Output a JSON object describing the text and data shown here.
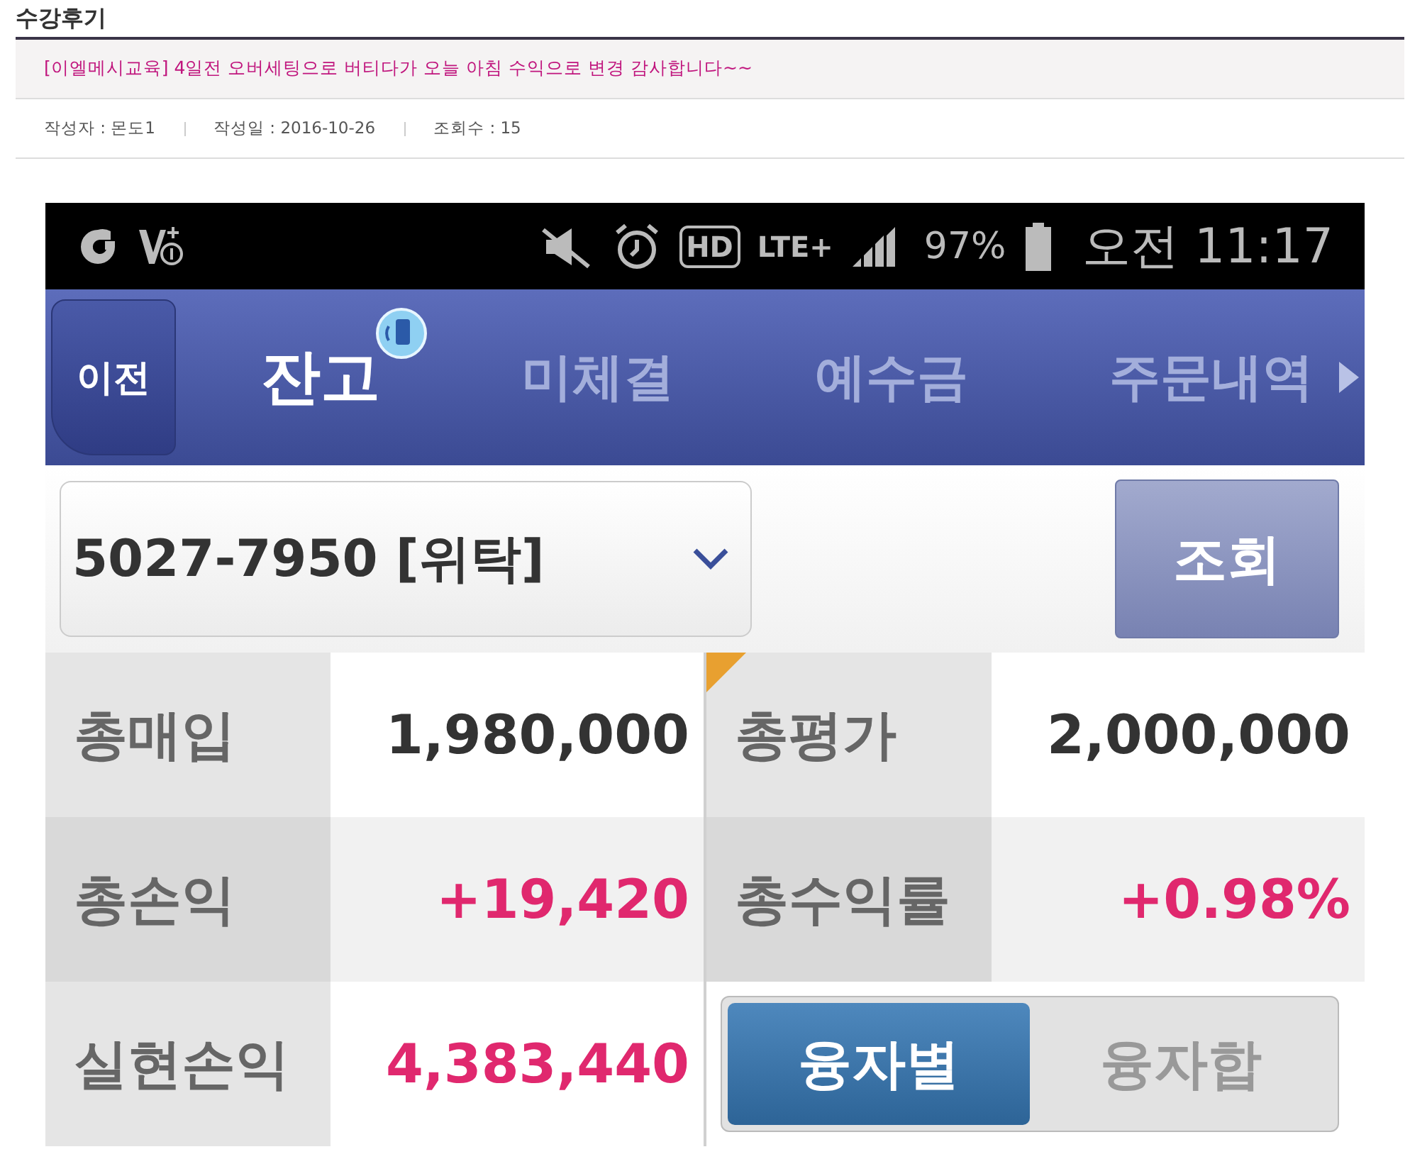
{
  "board": {
    "title": "수강후기"
  },
  "post": {
    "title": "[이엘메시교육] 4일전 오버세팅으로 버티다가 오늘 아침 수익으로 변경 감사합니다~~",
    "meta": [
      {
        "label": "작성자 : 몬도1"
      },
      {
        "label": "작성일 : 2016-10-26"
      },
      {
        "label": "조회수 : 15"
      }
    ]
  },
  "phone": {
    "status_bar": {
      "hd": "HD",
      "network": "LTE+",
      "battery": "97%",
      "time": "오전 11:17"
    },
    "back_button": "이전",
    "tabs": [
      {
        "label": "잔고",
        "selected": true
      },
      {
        "label": "미체결",
        "selected": false
      },
      {
        "label": "예수금",
        "selected": false
      },
      {
        "label": "주문내역",
        "selected": false
      }
    ],
    "account": {
      "value": "5027-7950 [위탁]"
    },
    "query_button": "조회",
    "summary": [
      {
        "label": "총매입",
        "value": "1,980,000",
        "color": "#333333",
        "flagged": false
      },
      {
        "label": "총평가",
        "value": "2,000,000",
        "color": "#333333",
        "flagged": true
      },
      {
        "label": "총손익",
        "value": "+19,420",
        "color": "#e0286e",
        "flagged": false
      },
      {
        "label": "총수익률",
        "value": "+0.98%",
        "color": "#e0286e",
        "flagged": false
      },
      {
        "label": "실현손익",
        "value": "4,383,440",
        "color": "#e0286e",
        "flagged": false
      }
    ],
    "toggle": [
      {
        "label": "융자별",
        "selected": true
      },
      {
        "label": "융자합",
        "selected": false
      }
    ]
  }
}
